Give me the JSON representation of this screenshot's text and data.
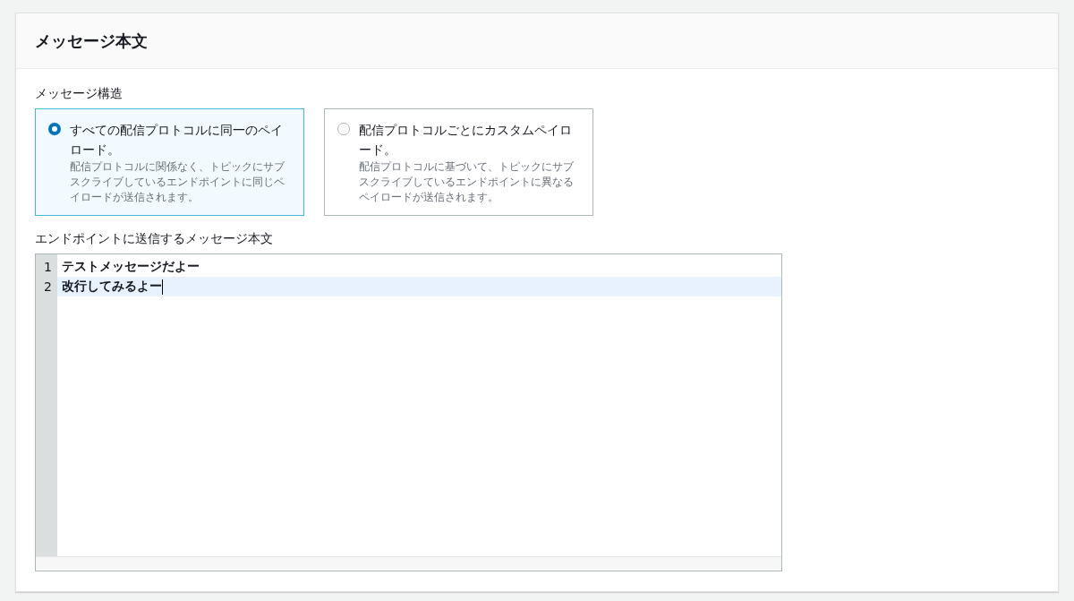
{
  "panel": {
    "title": "メッセージ本文"
  },
  "structure": {
    "label": "メッセージ構造",
    "options": [
      {
        "title": "すべての配信プロトコルに同一のペイロード。",
        "description": "配信プロトコルに関係なく、トピックにサブスクライブしているエンドポイントに同じペイロードが送信されます。",
        "selected": true
      },
      {
        "title": "配信プロトコルごとにカスタムペイロード。",
        "description": "配信プロトコルに基づいて、トピックにサブスクライブしているエンドポイントに異なるペイロードが送信されます。",
        "selected": false
      }
    ]
  },
  "editor": {
    "label": "エンドポイントに送信するメッセージ本文",
    "lines": [
      {
        "number": "1",
        "text": "テストメッセージだよー",
        "active": false
      },
      {
        "number": "2",
        "text": "改行してみるよー",
        "active": true
      }
    ]
  }
}
